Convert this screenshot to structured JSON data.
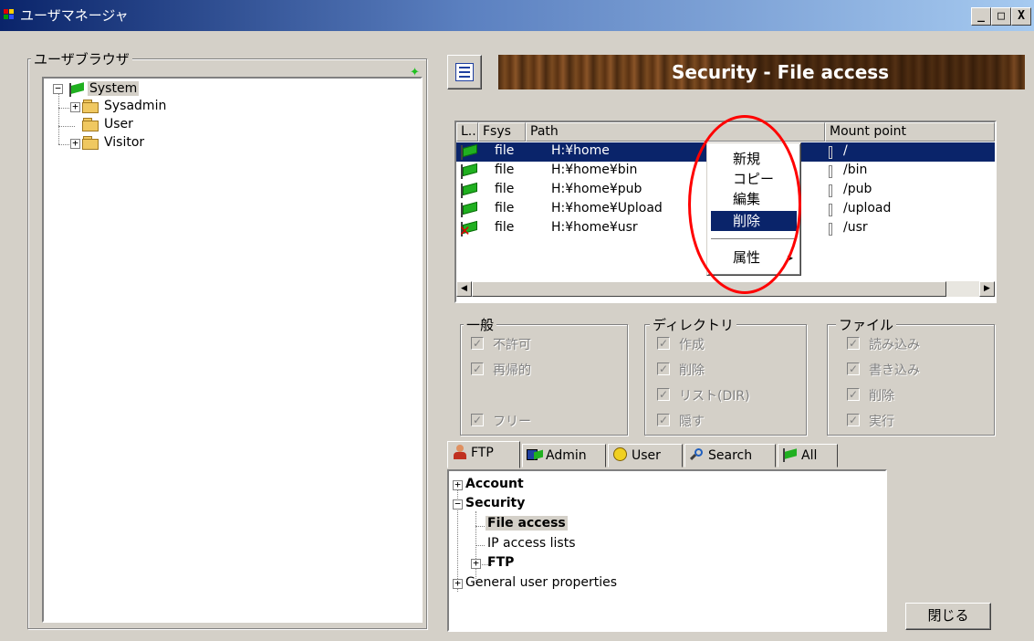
{
  "window": {
    "title": "ユーザマネージャ",
    "controls": {
      "minimize": "_",
      "maximize": "□",
      "close": "X"
    }
  },
  "user_browser": {
    "label": "ユーザブラウザ",
    "root": "System",
    "children": [
      "Sysadmin",
      "User",
      "Visitor"
    ]
  },
  "banner": {
    "title": "Security - File access"
  },
  "file_list": {
    "columns": [
      "L..",
      "Fsys",
      "Path",
      "Mount point"
    ],
    "rows": [
      {
        "fsys": "file",
        "path": "H:¥home",
        "mount": "/",
        "status": "enabled",
        "selected": true
      },
      {
        "fsys": "file",
        "path": "H:¥home¥bin",
        "mount": "/bin",
        "status": "enabled"
      },
      {
        "fsys": "file",
        "path": "H:¥home¥pub",
        "mount": "/pub",
        "status": "enabled"
      },
      {
        "fsys": "file",
        "path": "H:¥home¥Upload",
        "mount": "/upload",
        "status": "enabled"
      },
      {
        "fsys": "file",
        "path": "H:¥home¥usr",
        "mount": "/usr",
        "status": "disabled"
      }
    ]
  },
  "context_menu": {
    "items": [
      "新規",
      "コピー",
      "編集",
      "削除"
    ],
    "highlighted": "削除",
    "submenu_item": "属性",
    "submenu_arrow": "▸"
  },
  "groups": {
    "general": {
      "label": "一般",
      "items": [
        "不許可",
        "再帰的",
        "フリー"
      ]
    },
    "directory": {
      "label": "ディレクトリ",
      "items": [
        "作成",
        "削除",
        "リスト(DIR)",
        "隠す"
      ]
    },
    "file": {
      "label": "ファイル",
      "items": [
        "読み込み",
        "書き込み",
        "削除",
        "実行"
      ]
    },
    "check_mark": "✓"
  },
  "tabs": [
    "FTP",
    "Admin",
    "User",
    "Search",
    "All"
  ],
  "settings_tree": {
    "account": "Account",
    "security": "Security",
    "file_access": "File access",
    "ip_access": "IP access lists",
    "ftp": "FTP",
    "general": "General user properties"
  },
  "buttons": {
    "close": "閉じる"
  },
  "colors": {
    "selection": "#0a246a",
    "face": "#d4d0c8",
    "annotation_circle": "#ff0000"
  }
}
